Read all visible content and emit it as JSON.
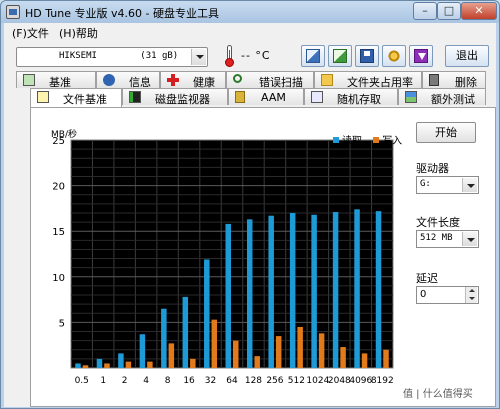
{
  "window": {
    "title": "HD Tune 专业版 v4.60 - 硬盘专业工具",
    "min_label": "–",
    "max_label": "□",
    "close_label": "✕"
  },
  "menu": {
    "file": "(F)文件",
    "help": "(H)帮助"
  },
  "toolbar": {
    "drive": "HIKSEMI        (31 gB)",
    "temperature": "-- °C",
    "exit_label": "退出",
    "buttons": [
      "copy-text-icon",
      "copy-screenshot-icon",
      "save-icon",
      "options-icon",
      "download-icon"
    ]
  },
  "tabs_row1": [
    "基准",
    "信息",
    "健康",
    "错误扫描",
    "文件夹占用率",
    "删除"
  ],
  "tabs_row2": [
    "文件基准",
    "磁盘监视器",
    "AAM",
    "随机存取",
    "额外测试"
  ],
  "chart": {
    "unit_label": "MB/秒"
  },
  "chart_data": {
    "type": "bar",
    "title": "",
    "xlabel": "",
    "ylabel": "MB/秒",
    "ylim": [
      0,
      25
    ],
    "yticks": [
      5,
      10,
      15,
      20,
      25
    ],
    "categories": [
      "0.5",
      "1",
      "2",
      "4",
      "8",
      "16",
      "32",
      "64",
      "128",
      "256",
      "512",
      "1024",
      "2048",
      "4096",
      "8192"
    ],
    "series": [
      {
        "name": "读取",
        "color": "#1e9bd7",
        "values": [
          0.5,
          1.0,
          1.6,
          3.7,
          6.5,
          7.8,
          11.9,
          15.8,
          16.3,
          16.7,
          17.0,
          16.8,
          17.1,
          17.4,
          17.2
        ]
      },
      {
        "name": "写入",
        "color": "#e07a1b",
        "values": [
          0.3,
          0.5,
          0.7,
          0.7,
          2.7,
          1.0,
          5.3,
          3.0,
          1.3,
          3.5,
          4.5,
          3.8,
          2.3,
          1.6,
          2.0
        ]
      }
    ],
    "grid": true,
    "legend": "top-right"
  },
  "side": {
    "start_label": "开始",
    "drive_label": "驱动器",
    "drive_value": "G:",
    "file_length_label": "文件长度",
    "file_length_value": "512 MB",
    "delay_label": "延迟",
    "delay_value": "0"
  },
  "watermark": "值 | 什么值得买"
}
